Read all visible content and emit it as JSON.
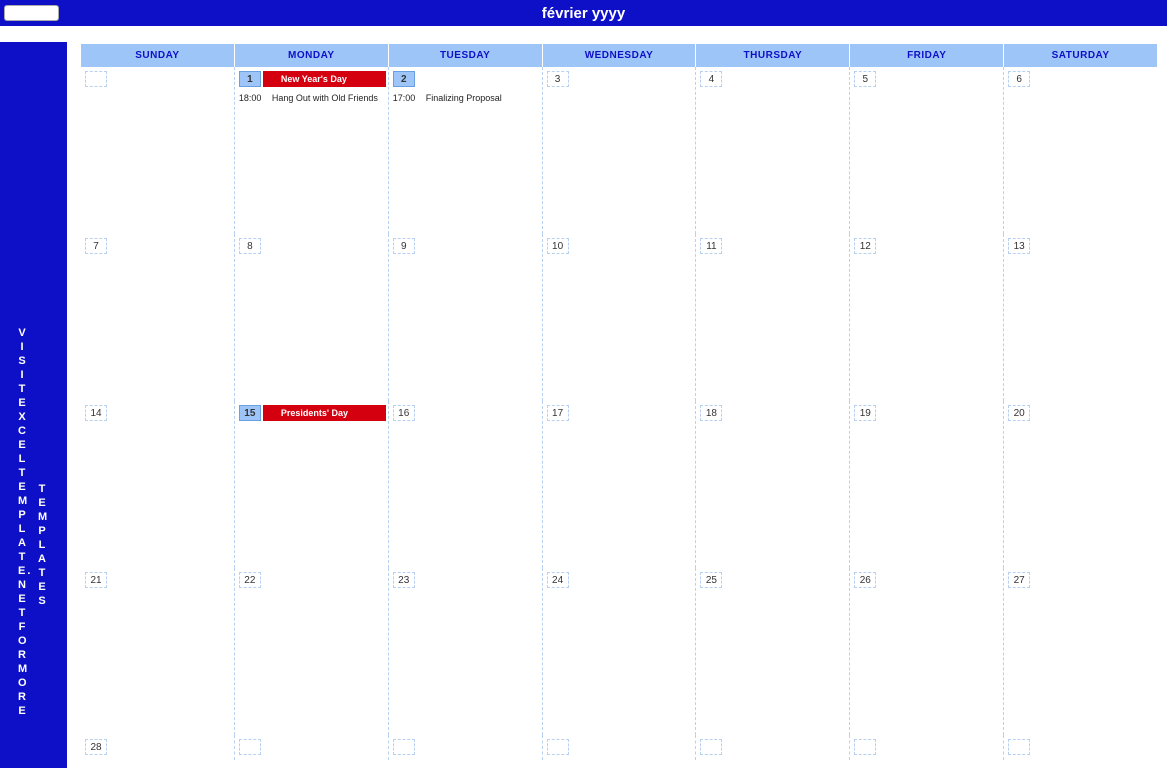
{
  "header": {
    "input_placeholder": "",
    "title": "février yyyy"
  },
  "sidebar": {
    "text1": "VISIT EXCELTEMPLATE.NET FOR MORE",
    "text2": "TEMPLATES"
  },
  "dayheaders": [
    "SUNDAY",
    "MONDAY",
    "TUESDAY",
    "WEDNESDAY",
    "THURSDAY",
    "FRIDAY",
    "SATURDAY"
  ],
  "weeks": [
    [
      {
        "num": ""
      },
      {
        "num": "1",
        "highlight": true,
        "holiday": "New Year's Day",
        "event": {
          "time": "18:00",
          "text": "Hang Out with Old Friends"
        }
      },
      {
        "num": "2",
        "highlight": true,
        "event": {
          "time": "17:00",
          "text": "Finalizing Proposal"
        }
      },
      {
        "num": "3"
      },
      {
        "num": "4"
      },
      {
        "num": "5"
      },
      {
        "num": "6"
      }
    ],
    [
      {
        "num": "7"
      },
      {
        "num": "8"
      },
      {
        "num": "9"
      },
      {
        "num": "10"
      },
      {
        "num": "11"
      },
      {
        "num": "12"
      },
      {
        "num": "13"
      }
    ],
    [
      {
        "num": "14"
      },
      {
        "num": "15",
        "highlight": true,
        "holiday": "Presidents' Day"
      },
      {
        "num": "16"
      },
      {
        "num": "17"
      },
      {
        "num": "18"
      },
      {
        "num": "19"
      },
      {
        "num": "20"
      }
    ],
    [
      {
        "num": "21"
      },
      {
        "num": "22"
      },
      {
        "num": "23"
      },
      {
        "num": "24"
      },
      {
        "num": "25"
      },
      {
        "num": "26"
      },
      {
        "num": "27"
      }
    ],
    [
      {
        "num": "28"
      },
      {
        "num": ""
      },
      {
        "num": ""
      },
      {
        "num": ""
      },
      {
        "num": ""
      },
      {
        "num": ""
      },
      {
        "num": ""
      }
    ]
  ]
}
